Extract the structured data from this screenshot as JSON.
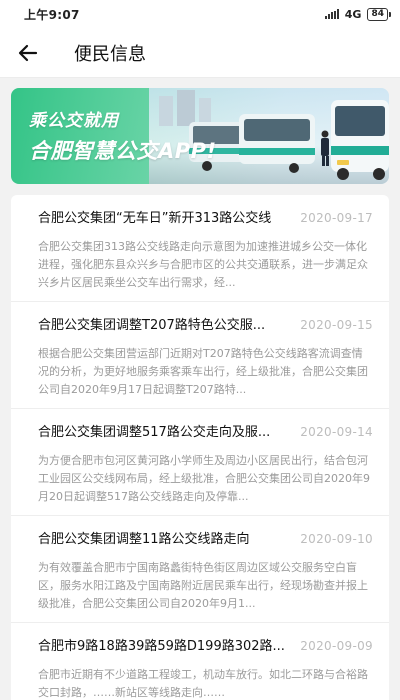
{
  "status_bar": {
    "time": "上午9:07",
    "network": "4G",
    "battery": "84"
  },
  "header": {
    "title": "便民信息"
  },
  "banner": {
    "line1": "乘公交就用",
    "line2": "合肥智慧公交APP!"
  },
  "news": [
    {
      "title": "合肥公交集团“无车日”新开313路公交线",
      "date": "2020-09-17",
      "summary": "合肥公交集团313路公交线路走向示意图为加速推进城乡公交一体化进程，强化肥东县众兴乡与合肥市区的公共交通联系，进一步满足众兴乡片区居民乘坐公交车出行需求，经..."
    },
    {
      "title": "合肥公交集团调整T207路特色公交服...",
      "date": "2020-09-15",
      "summary": "根据合肥公交集团营运部门近期对T207路特色公交线路客流调查情况的分析，为更好地服务乘客乘车出行，经上级批准，合肥公交集团公司自2020年9月17日起调整T207路特..."
    },
    {
      "title": "合肥公交集团调整517路公交走向及服...",
      "date": "2020-09-14",
      "summary": "为方便合肥市包河区黄河路小学师生及周边小区居民出行，结合包河工业园区公交线网布局，经上级批准，合肥公交集团公司自2020年9月20日起调整517路公交线路走向及停靠..."
    },
    {
      "title": "合肥公交集团调整11路公交线路走向",
      "date": "2020-09-10",
      "summary": "为有效覆盖合肥市宁国南路蠡街特色街区周边区域公交服务空白盲区，服务水阳江路及宁国南路附近居民乘车出行，经现场勘查并报上级批准，合肥公交集团公司自2020年9月1..."
    },
    {
      "title": "合肥市9路18路39路59路D199路302路...",
      "date": "2020-09-09",
      "summary": "合肥市近期有不少道路工程竣工，机动车放行。如北二环路与合裕路交口封路，……新站区等线路走向……"
    }
  ]
}
